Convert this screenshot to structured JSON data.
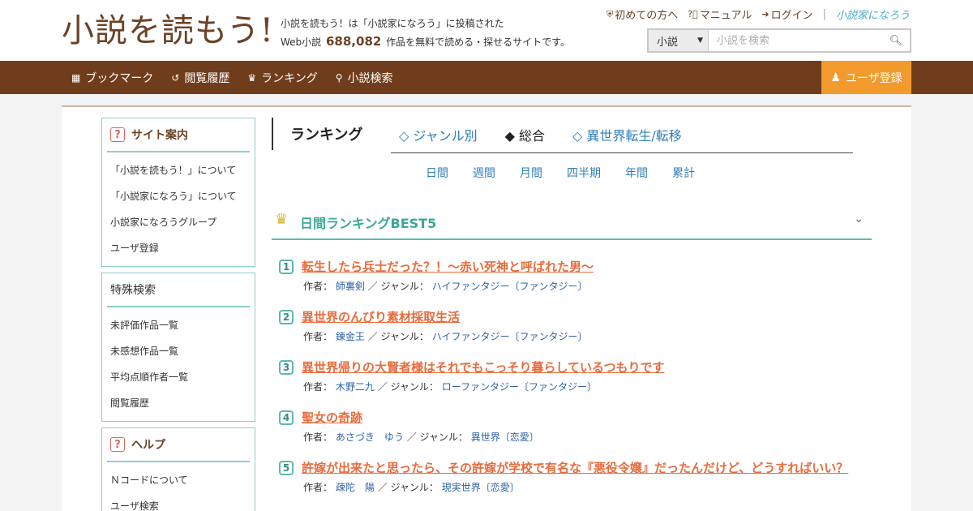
{
  "header": {
    "logo": "小説を読もう!",
    "tagline_line1": "小説を読もう！は「小説家になろう」に投稿された",
    "tagline_prefix": "Web小説",
    "work_count": "688,082",
    "tagline_suffix": "作品を無料で読める・探せるサイトです。",
    "links": {
      "beginners": "初めての方へ",
      "manual": "マニュアル",
      "login": "ログイン",
      "brand": "小説家になろう"
    },
    "search": {
      "category": "小説",
      "placeholder": "小説を検索"
    }
  },
  "nav": {
    "items": [
      "ブックマーク",
      "閲覧履歴",
      "ランキング",
      "小説検索"
    ],
    "register": "ユーザ登録"
  },
  "sidebar": {
    "site_guide": {
      "title": "サイト案内",
      "items": [
        "「小説を読もう！」について",
        "「小説家になろう」について",
        "小説家になろうグループ",
        "ユーザ登録"
      ]
    },
    "special_search": {
      "title": "特殊検索",
      "items": [
        "未評価作品一覧",
        "未感想作品一覧",
        "平均点順作者一覧",
        "閲覧履歴"
      ]
    },
    "help": {
      "title": "ヘルプ",
      "items": [
        "Ｎコードについて",
        "ユーザ検索"
      ]
    }
  },
  "ranking": {
    "title": "ランキング",
    "tabs": [
      "◇ ジャンル別",
      "◆ 総合",
      "◇ 異世界転生/転移"
    ],
    "periods": [
      "日間",
      "週間",
      "月間",
      "四半期",
      "年間",
      "累計"
    ],
    "best_title": "日間ランキングBEST5",
    "author_label": "作者：",
    "genre_label": "／ ジャンル：",
    "entries": [
      {
        "rank": "1",
        "title": "転生したら兵士だった？！〜赤い死神と呼ばれた男〜",
        "author": "師裏剣",
        "genre": "ハイファンタジー〔ファンタジー〕"
      },
      {
        "rank": "2",
        "title": "異世界のんびり素材採取生活",
        "author": "錬金王",
        "genre": "ハイファンタジー〔ファンタジー〕"
      },
      {
        "rank": "3",
        "title": "異世界帰りの大賢者様はそれでもこっそり暮らしているつもりです",
        "author": "木野二九",
        "genre": "ローファンタジー〔ファンタジー〕"
      },
      {
        "rank": "4",
        "title": "聖女の奇跡",
        "author": "あさづき　ゆう",
        "genre": "異世界〔恋愛〕"
      },
      {
        "rank": "5",
        "title": "許嫁が出来たと思ったら、その許嫁が学校で有名な『悪役令嬢』だったんだけど、どうすればいい？",
        "author": "疎陀　陽",
        "genre": "現実世界〔恋愛〕"
      }
    ]
  }
}
